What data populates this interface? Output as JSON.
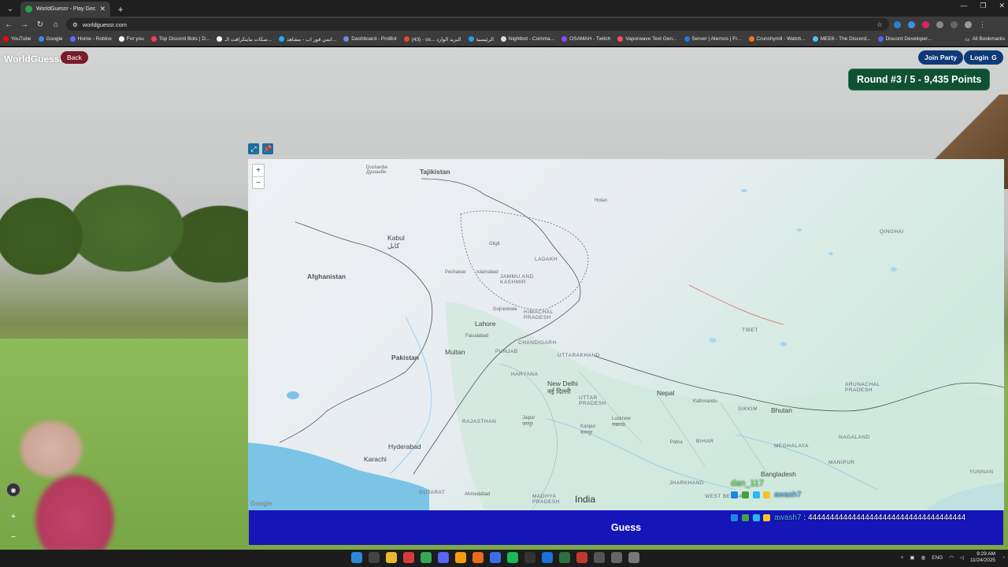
{
  "browser": {
    "tab_title": "WorldGuessr - Play Geoguessr",
    "url": "worldguessr.com",
    "bookmarks": [
      {
        "label": "YouTube",
        "color": "#ff0000"
      },
      {
        "label": "Google",
        "color": "#4285f4"
      },
      {
        "label": "Home - Roblox",
        "color": "#5a6cff"
      },
      {
        "label": "For you",
        "color": "#ffffff"
      },
      {
        "label": "Top Discord Bots | D...",
        "color": "#ff3860"
      },
      {
        "label": "سكات مايتكرافت الـ...",
        "color": "#ffffff"
      },
      {
        "label": "انمي فور اب - مشاهد...",
        "color": "#22aaff"
      },
      {
        "label": "Dashboard - ProBot",
        "color": "#7289da"
      },
      {
        "label": "(43) - os... البريد الوارد",
        "color": "#ea4335"
      },
      {
        "label": "الرئيسية",
        "color": "#1da1f2"
      },
      {
        "label": "Nightbot - Comma...",
        "color": "#dddddd"
      },
      {
        "label": "OSAMAH - Twitch",
        "color": "#9146ff"
      },
      {
        "label": "Vaporwave Text Gen...",
        "color": "#ff4d6d"
      },
      {
        "label": "Server | Aternos | Fr...",
        "color": "#2277dd"
      },
      {
        "label": "Crunchyroll - Watch...",
        "color": "#f47521"
      },
      {
        "label": "MEE6 - The Discord...",
        "color": "#4fc3f7"
      },
      {
        "label": "Discord Developer...",
        "color": "#5865f2"
      }
    ],
    "all_bookmarks": "All Bookmarks"
  },
  "game": {
    "brand": "WorldGuessr",
    "back": "Back",
    "join_party": "Join Party",
    "login": "Login",
    "login_icon": "G",
    "round": "Round #3 / 5 - 9,435 Points",
    "guess": "Guess"
  },
  "map": {
    "zoom_in": "+",
    "zoom_out": "−",
    "attribution": "Google",
    "labels": {
      "tajikistan": "Tajikistan",
      "dushanbe": "Dushanbe\nДушанбе",
      "afghanistan": "Afghanistan",
      "kabul": "Kabul\nکابل",
      "pakistan": "Pakistan",
      "multan": "Multan",
      "lahore": "Lahore",
      "ladakh": "LADAKH",
      "jammu": "JAMMU AND\nKASHMIR",
      "himachal": "HIMACHAL\nPRADESH",
      "punjab": "PUNJAB",
      "chandigarh": "CHANDIGARH",
      "uttarakhand": "UTTARAKHAND",
      "haryana": "HARYANA",
      "delhi": "New Delhi\nनई दिल्ली",
      "uttar": "UTTAR\nPRADESH",
      "rajasthan": "RAJASTHAN",
      "jaipur": "Jaipur\nजयपुर",
      "kanpur": "Kanpur\nकानपुर",
      "lucknow": "Lucknow\nलखनऊ",
      "nepal": "Nepal",
      "kathmandu": "Kathmandu",
      "bhutan": "Bhutan",
      "sikkim": "SIKKIM",
      "tibet": "TIBET",
      "qinghai": "QINGHAI",
      "arunachal": "ARUNACHAL\nPRADESH",
      "nagaland": "NAGALAND",
      "meghalaya": "MEGHALAYA",
      "manipur": "MANIPUR",
      "bangladesh": "Bangladesh",
      "bihar": "BIHAR",
      "patna": "Patna",
      "jharkhand": "JHARKHAND",
      "west_bengal": "WEST BENGAL",
      "india": "India",
      "gujarat": "GUJARAT",
      "ahmedabad": "Ahmedabad",
      "madhya": "MADHYA\nPRADESH",
      "karachi": "Karachi",
      "hyderabad": "Hyderabad",
      "yunnan": "YUNNAN",
      "hotan": "Hotan",
      "gilgit": "Gilgit",
      "peshawar": "Peshawar",
      "islamabad": "Islamabad",
      "gujranwala": "Gujranwala",
      "faisalabad": "Faisalabad"
    }
  },
  "chat": {
    "user1": "dan_117",
    "user2": "awash7",
    "line3_user": "awash7",
    "line3_msg": "444444444444444444444444444444444444"
  },
  "taskbar": {
    "lang": "ENG",
    "time": "9:29 AM",
    "date": "11/24/2025"
  }
}
